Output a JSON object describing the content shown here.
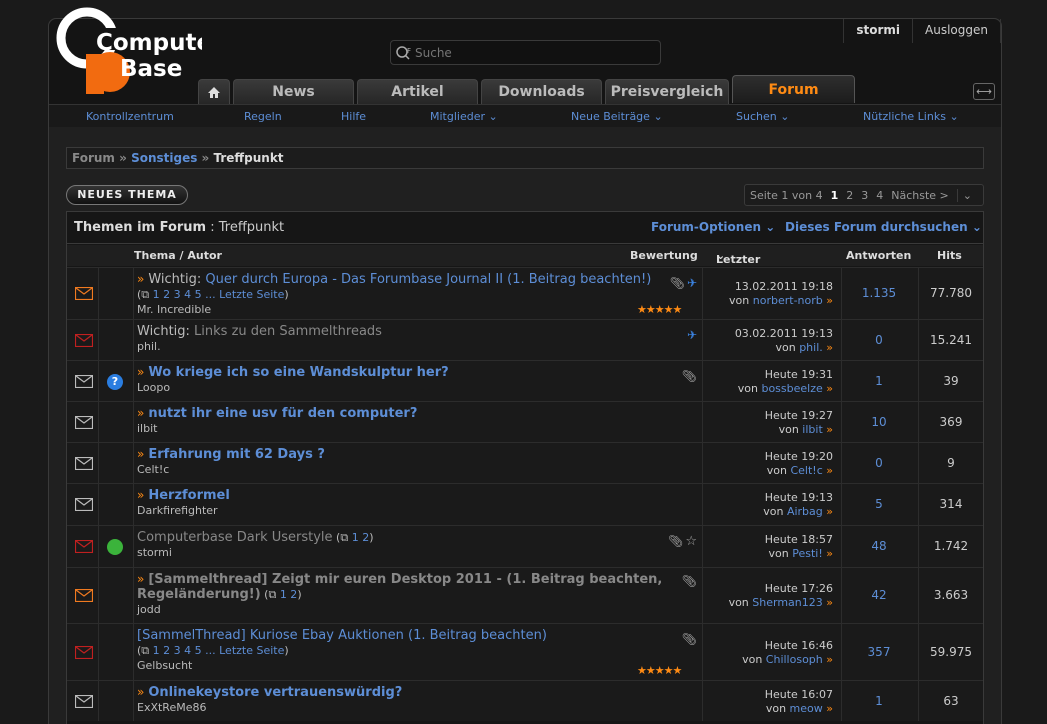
{
  "header": {
    "logo_line1": "Computer",
    "logo_line2": "Base",
    "username": "stormi",
    "logout": "Ausloggen",
    "search_placeholder": "Suche"
  },
  "tabs": [
    "News",
    "Artikel",
    "Downloads",
    "Preisvergleich",
    "Forum"
  ],
  "subnav": [
    "Kontrollzentrum",
    "Regeln",
    "Hilfe",
    "Mitglieder",
    "Neue Beiträge",
    "Suchen",
    "Nützliche Links"
  ],
  "breadcrumb": {
    "root": "Forum",
    "sep": "»",
    "parent": "Sonstiges",
    "current": "Treffpunkt"
  },
  "new_thread": "NEUES THEMA",
  "pager": {
    "label": "Seite 1 von 4",
    "pages": [
      "1",
      "2",
      "3",
      "4"
    ],
    "next": "Nächste >"
  },
  "forum": {
    "title": "Themen im Forum",
    "forum_name": " : Treffpunkt",
    "options": "Forum-Optionen",
    "search": "Dieses Forum durchsuchen"
  },
  "columns": {
    "thema": "Thema / Autor",
    "bewertung": "Bewertung",
    "last": "Letzter Beitrag",
    "antworten": "Antworten",
    "hits": "Hits"
  },
  "threads": [
    {
      "prefix": "Wichtig:",
      "title": "Quer durch Europa - Das Forumbase Journal II (1. Beitrag beachten!)",
      "pages": "1 2 3 4 5 ... Letzte Seite",
      "author": "Mr. Incredible",
      "date": "13.02.2011 19:18",
      "by": "norbert-norb",
      "replies": "1.135",
      "hits": "77.780",
      "stars": "★★★★★"
    },
    {
      "prefix": "Wichtig:",
      "title": "Links zu den Sammelthreads",
      "pages": "",
      "author": "phil.",
      "date": "03.02.2011 19:13",
      "by": "phil.",
      "replies": "0",
      "hits": "15.241",
      "stars": ""
    },
    {
      "prefix": "",
      "title": "Wo kriege ich so eine Wandskulptur her?",
      "pages": "",
      "author": "Loopo",
      "date": "Heute 19:31",
      "by": "bossbeelze",
      "replies": "1",
      "hits": "39",
      "stars": ""
    },
    {
      "prefix": "",
      "title": "nutzt ihr eine usv für den computer?",
      "pages": "",
      "author": "ilbit",
      "date": "Heute 19:27",
      "by": "ilbit",
      "replies": "10",
      "hits": "369",
      "stars": ""
    },
    {
      "prefix": "",
      "title": "Erfahrung mit 62 Days ?",
      "pages": "",
      "author": "Celt!c",
      "date": "Heute 19:20",
      "by": "Celt!c",
      "replies": "0",
      "hits": "9",
      "stars": ""
    },
    {
      "prefix": "",
      "title": "Herzformel",
      "pages": "",
      "author": "Darkfirefighter",
      "date": "Heute 19:13",
      "by": "Airbag",
      "replies": "5",
      "hits": "314",
      "stars": ""
    },
    {
      "prefix": "",
      "title": "Computerbase Dark Userstyle",
      "pages": "1 2",
      "author": "stormi",
      "date": "Heute 18:57",
      "by": "Pesti!",
      "replies": "48",
      "hits": "1.742",
      "stars": ""
    },
    {
      "prefix": "",
      "title": "[Sammelthread] Zeigt mir euren Desktop 2011 - (1. Beitrag beachten, Regeländerung!)",
      "pages": "1 2",
      "author": "jodd",
      "date": "Heute 17:26",
      "by": "Sherman123",
      "replies": "42",
      "hits": "3.663",
      "stars": ""
    },
    {
      "prefix": "",
      "title": "[SammelThread] Kuriose Ebay Auktionen (1. Beitrag beachten)",
      "pages": "1 2 3 4 5 ... Letzte Seite",
      "author": "Gelbsucht",
      "date": "Heute 16:46",
      "by": "Chillosoph",
      "replies": "357",
      "hits": "59.975",
      "stars": "★★★★★"
    },
    {
      "prefix": "",
      "title": "Onlinekeystore vertrauenswürdig?",
      "pages": "",
      "author": "ExXtReMe86",
      "date": "Heute 16:07",
      "by": "meow",
      "replies": "1",
      "hits": "63",
      "stars": ""
    }
  ]
}
